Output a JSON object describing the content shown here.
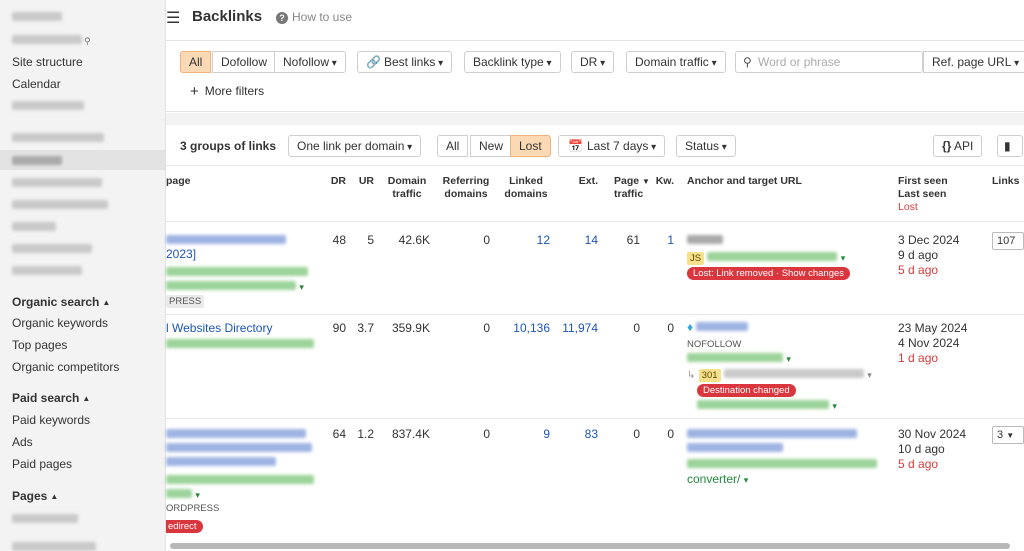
{
  "sidebar": {
    "site_structure": "Site structure",
    "calendar": "Calendar",
    "organic_search": "Organic search",
    "organic_keywords": "Organic keywords",
    "top_pages": "Top pages",
    "organic_competitors": "Organic competitors",
    "paid_search": "Paid search",
    "paid_keywords": "Paid keywords",
    "ads": "Ads",
    "paid_pages": "Paid pages",
    "pages": "Pages"
  },
  "header": {
    "title": "Backlinks",
    "how_to_use": "How to use"
  },
  "filters": {
    "all": "All",
    "dofollow": "Dofollow",
    "nofollow": "Nofollow",
    "best_links": "Best links",
    "backlink_type": "Backlink type",
    "dr": "DR",
    "domain_traffic": "Domain traffic",
    "search_placeholder": "Word or phrase",
    "ref_page_url": "Ref. page URL",
    "more_filters": "More filters"
  },
  "toolbar": {
    "groups_count": "3 groups of links",
    "one_link_per_domain": "One link per domain",
    "tab_all": "All",
    "tab_new": "New",
    "tab_lost": "Lost",
    "period": "Last 7 days",
    "status": "Status",
    "api": "API"
  },
  "table": {
    "headers": {
      "page": "page",
      "dr": "DR",
      "ur": "UR",
      "domain_traffic_1": "Domain",
      "domain_traffic_2": "traffic",
      "referring_domains_1": "Referring",
      "referring_domains_2": "domains",
      "linked_domains_1": "Linked",
      "linked_domains_2": "domains",
      "ext": "Ext.",
      "page_traffic_1": "Page",
      "page_traffic_2": "traffic",
      "kw": "Kw.",
      "anchor": "Anchor and target URL",
      "first_seen": "First seen",
      "last_seen": "Last seen",
      "lost": "Lost",
      "links": "Links"
    },
    "rows": [
      {
        "title": "2023]",
        "platform": "PRESS",
        "dr": "48",
        "ur": "5",
        "domain_traffic": "42.6K",
        "referring_domains": "0",
        "linked_domains": "12",
        "ext": "14",
        "page_traffic": "61",
        "kw": "1",
        "tag": "JS",
        "status_pill": "Lost: Link removed · Show changes",
        "first_seen": "3 Dec 2024",
        "last_seen": "9 d ago",
        "lost": "5 d ago",
        "links": "107"
      },
      {
        "title": "l Websites Directory",
        "dr": "90",
        "ur": "3.7",
        "domain_traffic": "359.9K",
        "referring_domains": "0",
        "linked_domains": "10,136",
        "ext": "11,974",
        "page_traffic": "0",
        "kw": "0",
        "tag": "NOFOLLOW",
        "redirect_code": "301",
        "status_pill": "Destination changed",
        "first_seen": "23 May 2024",
        "last_seen": "4 Nov 2024",
        "lost": "1 d ago"
      },
      {
        "platform": "ORDPRESS",
        "redirect_tag": "edirect",
        "dr": "64",
        "ur": "1.2",
        "domain_traffic": "837.4K",
        "referring_domains": "0",
        "linked_domains": "9",
        "ext": "83",
        "page_traffic": "0",
        "kw": "0",
        "anchor_tail": "converter/",
        "first_seen": "30 Nov 2024",
        "last_seen": "10 d ago",
        "lost": "5 d ago",
        "links": "3"
      }
    ]
  }
}
